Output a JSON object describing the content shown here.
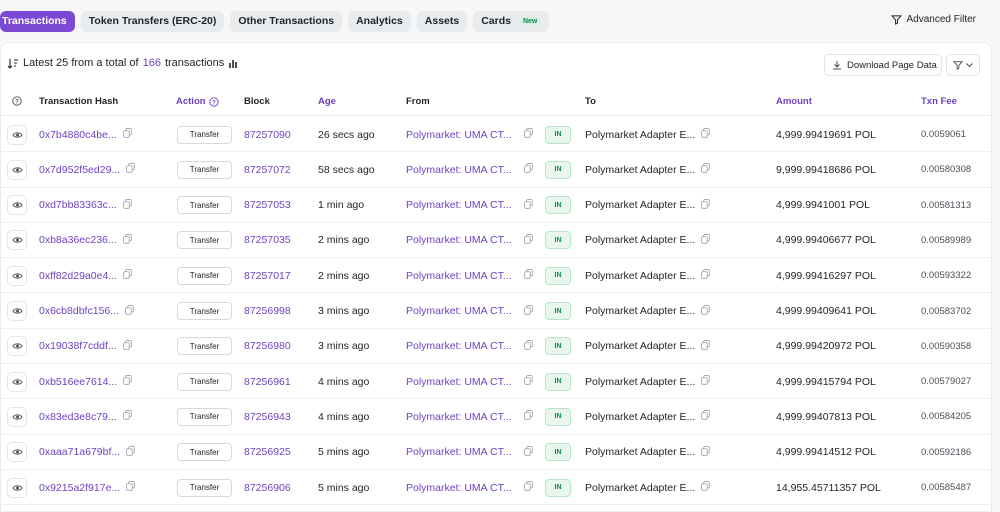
{
  "tabs": [
    {
      "label": "Transactions",
      "active": true
    },
    {
      "label": "Token Transfers (ERC-20)",
      "active": false
    },
    {
      "label": "Other Transactions",
      "active": false
    },
    {
      "label": "Analytics",
      "active": false
    },
    {
      "label": "Assets",
      "active": false
    },
    {
      "label": "Cards",
      "active": false,
      "badge": "New"
    }
  ],
  "advanced_filter": {
    "label": "Advanced Filter",
    "icon": "filter-icon"
  },
  "summary": {
    "prefix": "Latest 25 from a total of",
    "count": "166",
    "suffix": "transactions"
  },
  "download_button": {
    "label": "Download Page Data"
  },
  "columns": {
    "hash": "Transaction Hash",
    "action": "Action",
    "block": "Block",
    "age": "Age",
    "from": "From",
    "to": "To",
    "amount": "Amount",
    "fee": "Txn Fee"
  },
  "rows": [
    {
      "hash": "0x7b4880c4be...",
      "method": "Transfer",
      "block": "87257090",
      "age": "26 secs ago",
      "from": "Polymarket: UMA CT...",
      "dir": "IN",
      "to": "Polymarket Adapter E...",
      "amount": "4,999.99419691 POL",
      "fee": "0.0059061"
    },
    {
      "hash": "0x7d952f5ed29...",
      "method": "Transfer",
      "block": "87257072",
      "age": "58 secs ago",
      "from": "Polymarket: UMA CT...",
      "dir": "IN",
      "to": "Polymarket Adapter E...",
      "amount": "9,999.99418686 POL",
      "fee": "0.00580308"
    },
    {
      "hash": "0xd7bb83363c...",
      "method": "Transfer",
      "block": "87257053",
      "age": "1 min ago",
      "from": "Polymarket: UMA CT...",
      "dir": "IN",
      "to": "Polymarket Adapter E...",
      "amount": "4,999.9941001 POL",
      "fee": "0.00581313"
    },
    {
      "hash": "0xb8a36ec236...",
      "method": "Transfer",
      "block": "87257035",
      "age": "2 mins ago",
      "from": "Polymarket: UMA CT...",
      "dir": "IN",
      "to": "Polymarket Adapter E...",
      "amount": "4,999.99406677 POL",
      "fee": "0.00589989"
    },
    {
      "hash": "0xff82d29a0e4...",
      "method": "Transfer",
      "block": "87257017",
      "age": "2 mins ago",
      "from": "Polymarket: UMA CT...",
      "dir": "IN",
      "to": "Polymarket Adapter E...",
      "amount": "4,999.99416297 POL",
      "fee": "0.00593322"
    },
    {
      "hash": "0x6cb8dbfc156...",
      "method": "Transfer",
      "block": "87256998",
      "age": "3 mins ago",
      "from": "Polymarket: UMA CT...",
      "dir": "IN",
      "to": "Polymarket Adapter E...",
      "amount": "4,999.99409641 POL",
      "fee": "0.00583702"
    },
    {
      "hash": "0x19038f7cddf...",
      "method": "Transfer",
      "block": "87256980",
      "age": "3 mins ago",
      "from": "Polymarket: UMA CT...",
      "dir": "IN",
      "to": "Polymarket Adapter E...",
      "amount": "4,999.99420972 POL",
      "fee": "0.00590358"
    },
    {
      "hash": "0xb516ee7614...",
      "method": "Transfer",
      "block": "87256961",
      "age": "4 mins ago",
      "from": "Polymarket: UMA CT...",
      "dir": "IN",
      "to": "Polymarket Adapter E...",
      "amount": "4,999.99415794 POL",
      "fee": "0.00579027"
    },
    {
      "hash": "0x83ed3e8c79...",
      "method": "Transfer",
      "block": "87256943",
      "age": "4 mins ago",
      "from": "Polymarket: UMA CT...",
      "dir": "IN",
      "to": "Polymarket Adapter E...",
      "amount": "4,999.99407813 POL",
      "fee": "0.00584205"
    },
    {
      "hash": "0xaaa71a679bf...",
      "method": "Transfer",
      "block": "87256925",
      "age": "5 mins ago",
      "from": "Polymarket: UMA CT...",
      "dir": "IN",
      "to": "Polymarket Adapter E...",
      "amount": "4,999.99414512 POL",
      "fee": "0.00592186"
    },
    {
      "hash": "0x9215a2f917e...",
      "method": "Transfer",
      "block": "87256906",
      "age": "5 mins ago",
      "from": "Polymarket: UMA CT...",
      "dir": "IN",
      "to": "Polymarket Adapter E...",
      "amount": "14,955.45711357 POL",
      "fee": "0.00585487"
    }
  ],
  "colors": {
    "accent": "#7b49d3",
    "link": "#6f42c1",
    "in_badge": "#0a8a4e"
  }
}
